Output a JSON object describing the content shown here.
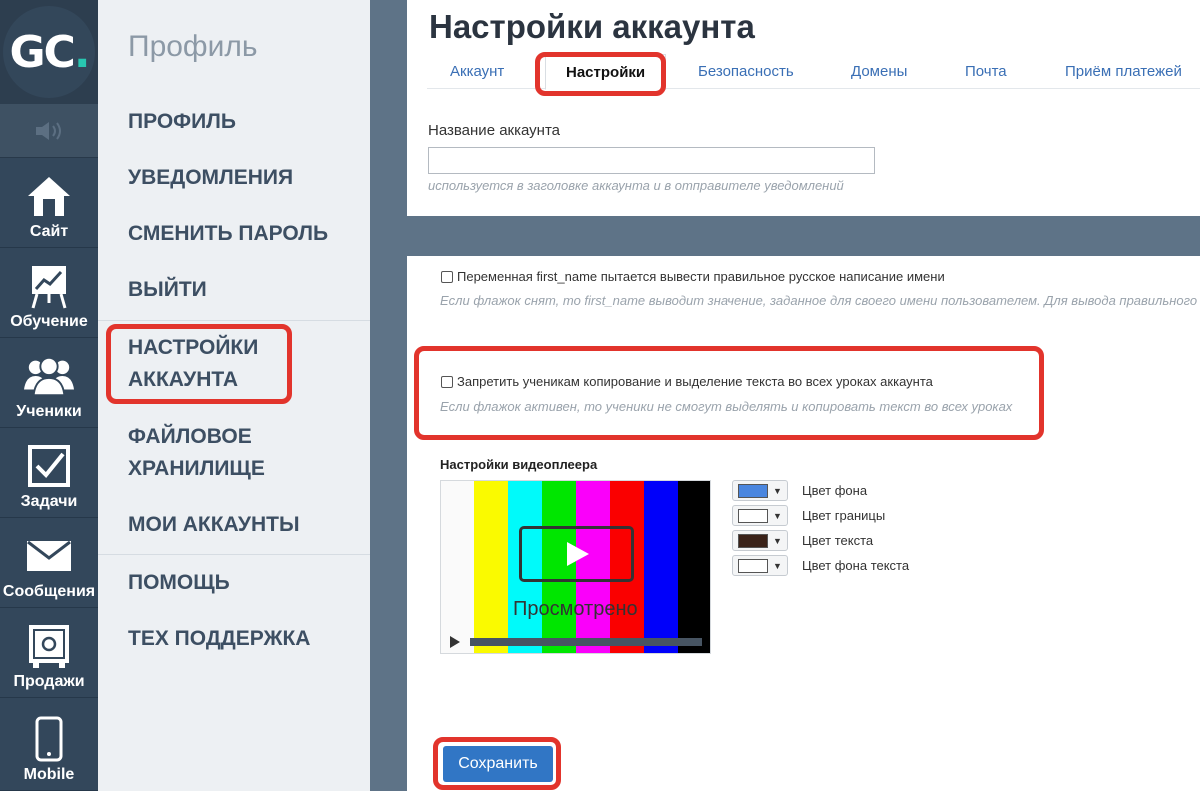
{
  "logo": {
    "text": "GC",
    "dot": "."
  },
  "iconbar": {
    "items": [
      {
        "label": "Сайт",
        "icon": "house-icon"
      },
      {
        "label": "Обучение",
        "icon": "chart-board-icon"
      },
      {
        "label": "Ученики",
        "icon": "users-icon"
      },
      {
        "label": "Задачи",
        "icon": "checkbox-icon"
      },
      {
        "label": "Сообщения",
        "icon": "envelope-icon"
      },
      {
        "label": "Продажи",
        "icon": "safe-icon"
      },
      {
        "label": "Mobile",
        "icon": "phone-icon"
      }
    ]
  },
  "menu": {
    "title": "Профиль",
    "items": [
      {
        "label": "ПРОФИЛЬ"
      },
      {
        "label": "УВЕДОМЛЕНИЯ"
      },
      {
        "label": "СМЕНИТЬ ПАРОЛЬ"
      },
      {
        "label": "ВЫЙТИ"
      },
      {
        "label": "НАСТРОЙКИ АККАУНТА"
      },
      {
        "label": "ФАЙЛОВОЕ ХРАНИЛИЩЕ"
      },
      {
        "label": "МОИ АККАУНТЫ"
      },
      {
        "label": "ПОМОЩЬ"
      },
      {
        "label": "ТЕХ ПОДДЕРЖКА"
      }
    ]
  },
  "page": {
    "title": "Настройки аккаунта",
    "tabs": [
      {
        "label": "Аккаунт"
      },
      {
        "label": "Настройки",
        "active": true
      },
      {
        "label": "Безопасность"
      },
      {
        "label": "Домены"
      },
      {
        "label": "Почта"
      },
      {
        "label": "Приём платежей"
      }
    ]
  },
  "account_name": {
    "label": "Название аккаунта",
    "value": "",
    "hint": "используется в заголовке аккаунта и в отправителе уведомлений"
  },
  "options": {
    "first_name": {
      "label": "Переменная first_name пытается вывести правильное русское написание имени",
      "hint": "Если флажок снят, то first_name выводит значение, заданное для своего имени пользователем. Для вывода правильного",
      "checked": false
    },
    "no_copy": {
      "label": "Запретить ученикам копирование и выделение текста во всех уроках аккаунта",
      "hint": "Если флажок активен, то ученики не смогут выделять и копировать текст во всех уроках",
      "checked": false
    }
  },
  "video_player": {
    "title": "Настройки видеоплеера",
    "preview_text": "Просмотрено",
    "colors": [
      {
        "label": "Цвет фона",
        "value": "#4a86df"
      },
      {
        "label": "Цвет границы",
        "value": "#ffffff"
      },
      {
        "label": "Цвет текста",
        "value": "#3a2219"
      },
      {
        "label": "Цвет фона текста",
        "value": "#ffffff"
      }
    ]
  },
  "save": {
    "label": "Сохранить"
  },
  "theme": {
    "accent": "#3176c5",
    "highlight": "#e2342c",
    "sidebar": "#2f4356"
  }
}
